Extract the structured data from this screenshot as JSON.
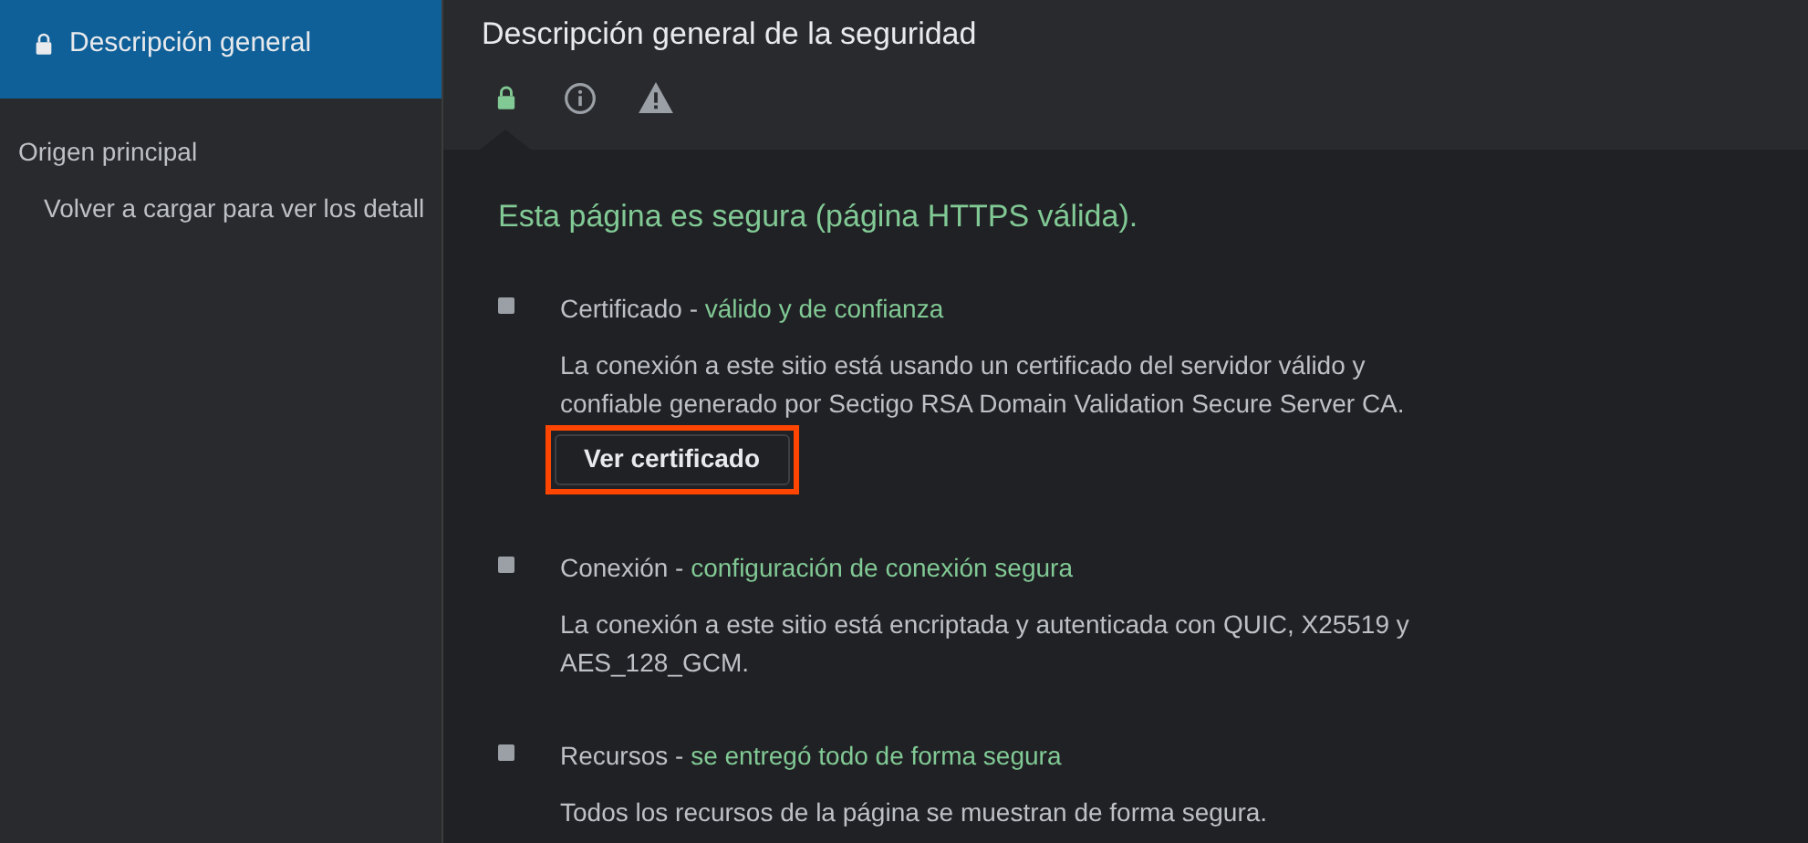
{
  "sidebar": {
    "items": [
      {
        "label": "Descripción general",
        "selected": true
      }
    ],
    "section_title": "Origen principal",
    "sub_items": [
      "Volver a cargar para ver los detall"
    ]
  },
  "main": {
    "title": "Descripción general de la seguridad",
    "tabs": [
      {
        "kind": "lock",
        "selected": true
      },
      {
        "kind": "info",
        "selected": false
      },
      {
        "kind": "warning",
        "selected": false
      }
    ],
    "headline": "Esta página es segura (página HTTPS válida).",
    "sections": [
      {
        "name": "Certificado",
        "separator": "-",
        "status": "válido y de confianza",
        "description": "La conexión a este sitio está usando un certificado del servidor válido y confiable generado por Sectigo RSA Domain Validation Secure Server CA.",
        "button": {
          "label": "Ver certificado",
          "highlighted": true
        }
      },
      {
        "name": "Conexión",
        "separator": "-",
        "status": "configuración de conexión segura",
        "description": "La conexión a este sitio está encriptada y autenticada con QUIC, X25519 y AES_128_GCM."
      },
      {
        "name": "Recursos",
        "separator": "-",
        "status": "se entregó todo de forma segura",
        "description": "Todos los recursos de la página se muestran de forma segura."
      }
    ]
  }
}
